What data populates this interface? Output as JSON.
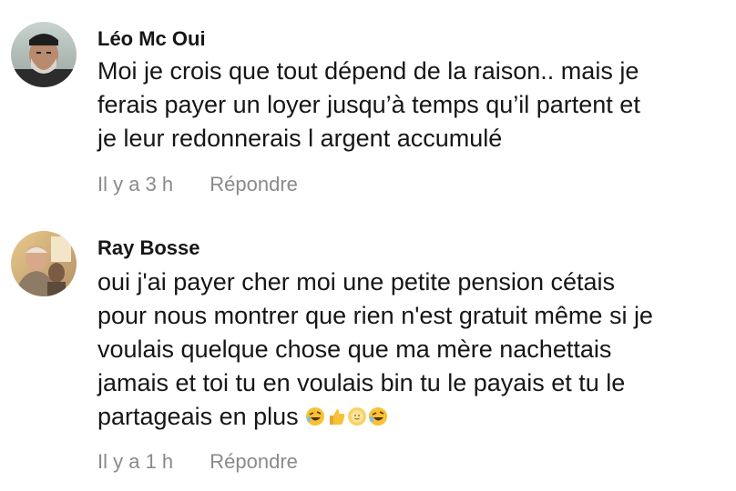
{
  "comments": [
    {
      "author": "Léo Mc Oui",
      "lines": [
        "Moi je crois que tout dépend de la raison.. mais je",
        "ferais payer un loyer jusqu’à temps qu’il partent et",
        "je leur redonnerais l argent accumulé"
      ],
      "time": "Il y a 3 h",
      "reply_label": "Répondre"
    },
    {
      "author": "Ray Bosse",
      "lines": [
        "oui j'ai payer cher moi une petite pension cétais",
        "pour nous montrer que rien n'est gratuit même si je",
        "voulais quelque chose que ma mère nachettais",
        "jamais et toi tu en voulais bin tu le payais et tu le",
        "partageais en plus"
      ],
      "emojis": [
        "rofl-emoji",
        "thumbs-up-emoji",
        "sun-emoji",
        "rofl-emoji"
      ],
      "time": "Il y a 1 h",
      "reply_label": "Répondre"
    }
  ],
  "colors": {
    "text": "#161616",
    "meta": "#8a8a8a",
    "background": "#ffffff"
  }
}
